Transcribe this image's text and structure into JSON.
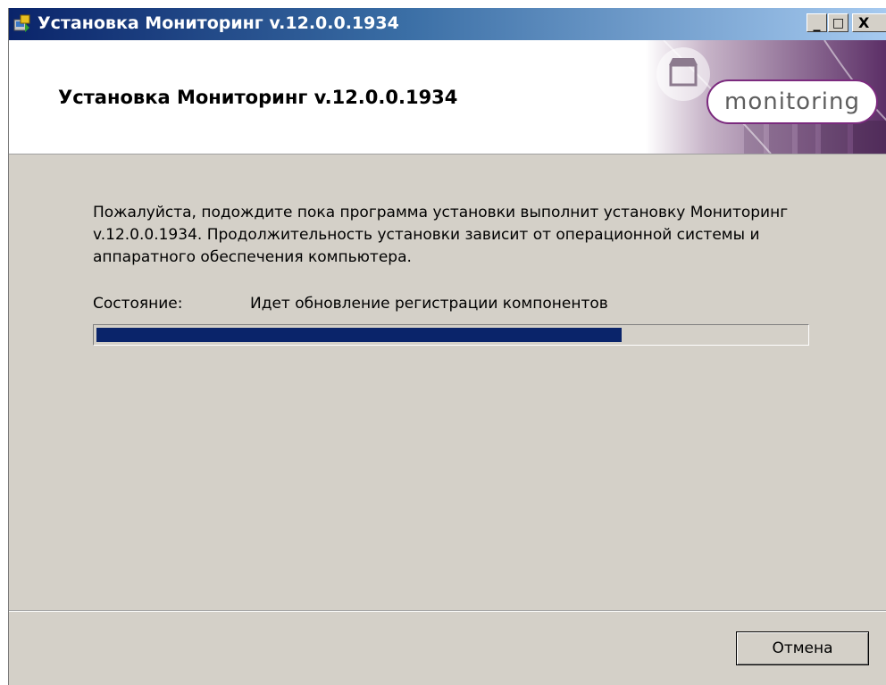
{
  "window": {
    "title": "Установка Мониторинг v.12.0.0.1934",
    "controls": {
      "minimize": "_",
      "maximize": "□",
      "close": "X"
    }
  },
  "header": {
    "title": "Установка Мониторинг v.12.0.0.1934",
    "logo_text": "monitoring"
  },
  "content": {
    "description": "Пожалуйста, подождите пока программа установки выполнит установку Мониторинг v.12.0.0.1934. Продолжительность установки зависит от операционной системы и аппаратного обеспечения компьютера.",
    "status_label": "Состояние:",
    "status_value": "Идет обновление регистрации компонентов",
    "progress_percent": 74
  },
  "footer": {
    "cancel_label": "Отмена"
  },
  "colors": {
    "progress_fill": "#0a246a",
    "dialog_bg": "#d4d0c8",
    "logo_accent": "#7b2a7e"
  },
  "icons": {
    "app": "installer-icon",
    "logo": "store-icon"
  }
}
